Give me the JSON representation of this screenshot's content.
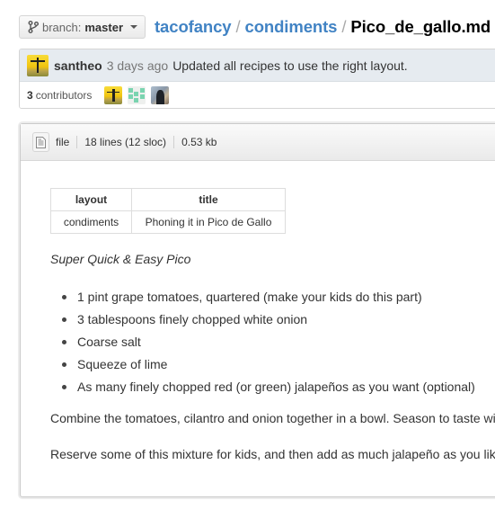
{
  "branch": {
    "label": "branch:",
    "name": "master",
    "icon": "git-branch-icon"
  },
  "breadcrumb": {
    "repo_owner": "tacofancy",
    "separator": "/",
    "folder": "condiments",
    "file": "Pico_de_gallo.md"
  },
  "commit": {
    "author": "santheo",
    "time": "3 days ago",
    "message": "Updated all recipes to use the right layout."
  },
  "contributors": {
    "count": "3",
    "label": "contributors",
    "avatars": [
      "santheo-avatar",
      "identicon-avatar",
      "photo-avatar"
    ]
  },
  "file_header": {
    "icon": "file-text-icon",
    "type": "file",
    "lines": "18 lines (12 sloc)",
    "size": "0.53 kb"
  },
  "front_matter": {
    "headers": [
      "layout",
      "title"
    ],
    "row": [
      "condiments",
      "Phoning it in Pico de Gallo"
    ]
  },
  "content": {
    "subtitle": "Super Quick & Easy Pico",
    "ingredients": [
      "1 pint grape tomatoes, quartered (make your kids do this part)",
      "3 tablespoons finely chopped white onion",
      "Coarse salt",
      "Squeeze of lime",
      "As many finely chopped red (or green) jalapeños as you want (optional)"
    ],
    "paragraphs": [
      "Combine the tomatoes, cilantro and onion together in a bowl. Season to taste with salt and lime.",
      "Reserve some of this mixture for kids, and then add as much jalapeño as you like."
    ]
  },
  "colors": {
    "link": "#4183c4",
    "commit_bg": "#e6ebf0"
  }
}
